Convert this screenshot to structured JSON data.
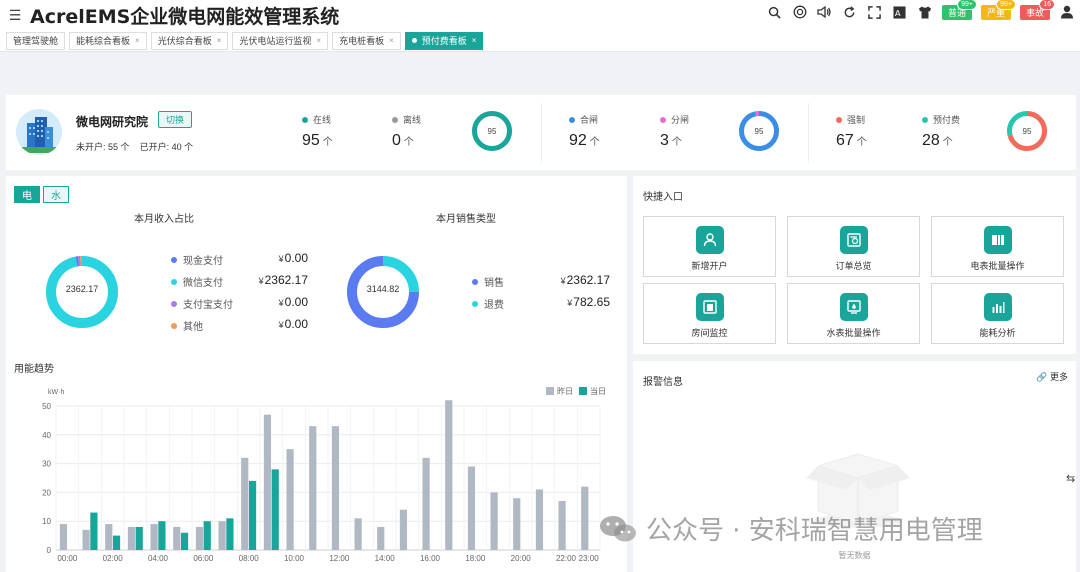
{
  "app": {
    "title": "AcrelEMS企业微电网能效管理系统"
  },
  "header": {
    "icons": [
      "search-icon",
      "help-icon",
      "volume-icon",
      "refresh-icon",
      "fullscreen-icon",
      "font-icon",
      "shirt-icon"
    ],
    "badges": [
      {
        "label": "普通",
        "count": "99+",
        "color": "#2dc26b"
      },
      {
        "label": "严重",
        "count": "99+",
        "color": "#f5b618"
      },
      {
        "label": "事故",
        "count": "16",
        "color": "#f05b5b"
      }
    ]
  },
  "tabs": [
    {
      "label": "管理驾驶舱",
      "closable": false,
      "active": false
    },
    {
      "label": "能耗综合看板",
      "closable": true,
      "active": false
    },
    {
      "label": "光伏综合看板",
      "closable": true,
      "active": false
    },
    {
      "label": "光伏电站运行监视",
      "closable": true,
      "active": false
    },
    {
      "label": "充电桩看板",
      "closable": true,
      "active": false
    },
    {
      "label": "预付费看板",
      "closable": true,
      "active": true
    }
  ],
  "summary": {
    "org_name": "微电网研究院",
    "switch_label": "切换",
    "unopened_label": "未开户: ",
    "unopened_value": "55",
    "opened_label": "已开户: ",
    "opened_value": "40",
    "unit": "个",
    "groups": [
      {
        "items": [
          {
            "label": "在线",
            "value": "95",
            "color": "#1aa59a"
          },
          {
            "label": "离线",
            "value": "0",
            "color": "#999999"
          }
        ],
        "ring": {
          "center": "95",
          "fractions": [
            1.0,
            0.0
          ],
          "colors": [
            "#1aa59a",
            "#d9d9d9"
          ]
        }
      },
      {
        "items": [
          {
            "label": "合闸",
            "value": "92",
            "color": "#3a8ee6"
          },
          {
            "label": "分闸",
            "value": "3",
            "color": "#e86ae2"
          }
        ],
        "ring": {
          "center": "95",
          "fractions": [
            0.968,
            0.032
          ],
          "colors": [
            "#3a8ee6",
            "#e86ae2"
          ]
        }
      },
      {
        "items": [
          {
            "label": "强制",
            "value": "67",
            "color": "#f06b5c"
          },
          {
            "label": "预付费",
            "value": "28",
            "color": "#26c6b0"
          }
        ],
        "ring": {
          "center": "95",
          "fractions": [
            0.705,
            0.295
          ],
          "colors": [
            "#f06b5c",
            "#26c6b0"
          ]
        }
      }
    ]
  },
  "income": {
    "toggle_elec": "电",
    "toggle_water": "水",
    "left_title": "本月收入占比",
    "left_center": "2362.17",
    "left_items": [
      {
        "label": "现金支付",
        "currency": "¥",
        "amount": "0.00",
        "color": "#5b7bf0"
      },
      {
        "label": "微信支付",
        "currency": "¥",
        "amount": "2362.17",
        "color": "#2ad3e0"
      },
      {
        "label": "支付宝支付",
        "currency": "¥",
        "amount": "0.00",
        "color": "#a77ee8"
      },
      {
        "label": "其他",
        "currency": "¥",
        "amount": "0.00",
        "color": "#f09a5a"
      }
    ],
    "right_title": "本月销售类型",
    "right_center": "3144.82",
    "right_items": [
      {
        "label": "销售",
        "currency": "¥",
        "amount": "2362.17",
        "color": "#5b7bf0"
      },
      {
        "label": "退费",
        "currency": "¥",
        "amount": "782.65",
        "color": "#2ad3e0"
      }
    ]
  },
  "trend": {
    "title": "用能趋势"
  },
  "chart_data": {
    "type": "bar",
    "title": "",
    "ylabel": "kW·h",
    "ylim": [
      0,
      50
    ],
    "yticks": [
      0,
      10,
      20,
      30,
      40,
      50
    ],
    "xticks": [
      "00:00",
      "02:00",
      "04:00",
      "06:00",
      "08:00",
      "10:00",
      "12:00",
      "14:00",
      "16:00",
      "18:00",
      "20:00",
      "22:00",
      "23:00"
    ],
    "categories": [
      "00",
      "01",
      "02",
      "03",
      "04",
      "05",
      "06",
      "07",
      "08",
      "09",
      "10",
      "11",
      "12",
      "13",
      "14",
      "15",
      "16",
      "17",
      "18",
      "19",
      "20",
      "21",
      "22",
      "23"
    ],
    "legend_position": "top-right",
    "series": [
      {
        "name": "昨日",
        "color": "#b0b8c4",
        "values": [
          9,
          7,
          9,
          8,
          9,
          8,
          8,
          10,
          32,
          47,
          35,
          43,
          43,
          11,
          8,
          14,
          32,
          52,
          29,
          20,
          18,
          21,
          17,
          22
        ]
      },
      {
        "name": "当日",
        "color": "#1aa59a",
        "values": [
          0,
          13,
          5,
          8,
          10,
          6,
          10,
          11,
          24,
          28,
          0,
          0,
          0,
          0,
          0,
          0,
          0,
          0,
          0,
          0,
          0,
          0,
          0,
          0
        ]
      }
    ]
  },
  "quick": {
    "title": "快捷入口",
    "items": [
      {
        "label": "新增开户",
        "icon": "add-user-icon"
      },
      {
        "label": "订单总览",
        "icon": "order-icon"
      },
      {
        "label": "电表批量操作",
        "icon": "meter-batch-icon"
      },
      {
        "label": "房间监控",
        "icon": "room-monitor-icon"
      },
      {
        "label": "水表批量操作",
        "icon": "water-meter-icon"
      },
      {
        "label": "能耗分析",
        "icon": "energy-analysis-icon"
      }
    ]
  },
  "alarm": {
    "title": "报警信息",
    "more": "更多",
    "empty": "暂无数据"
  },
  "watermark": {
    "text": "公众号 · 安科瑞智慧用电管理"
  }
}
